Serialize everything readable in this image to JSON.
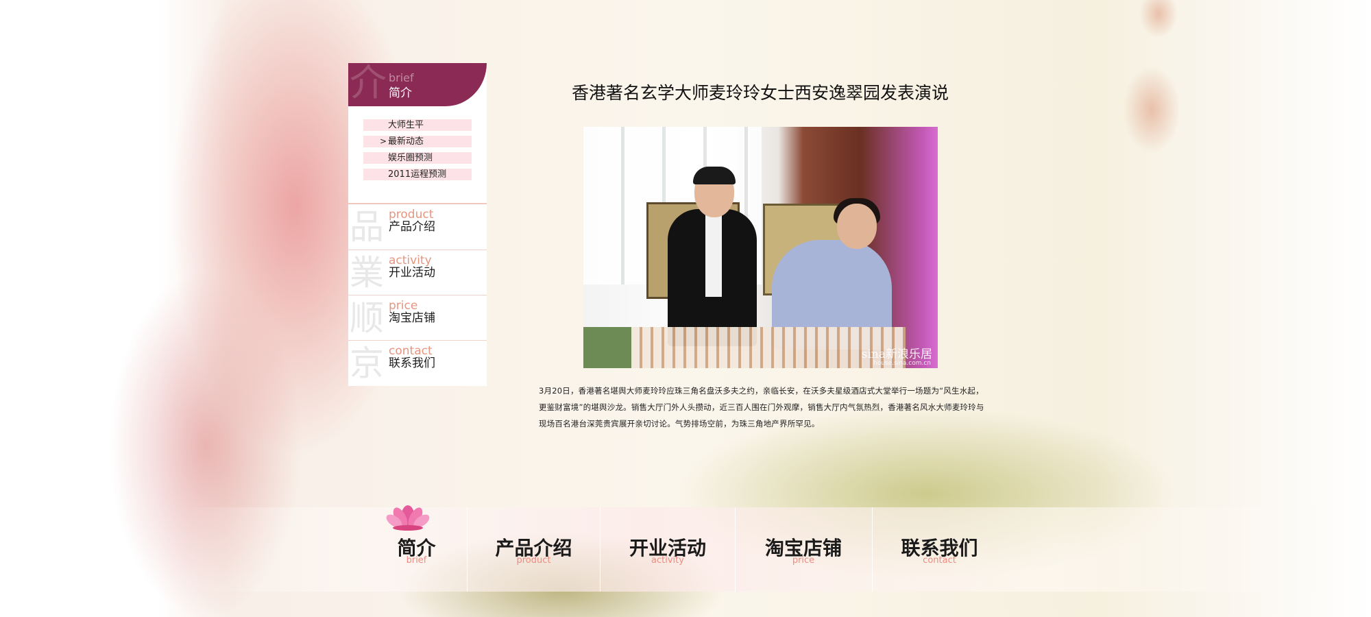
{
  "sidebar": {
    "brief": {
      "seal": "介",
      "en": "brief",
      "cn": "简介"
    },
    "sub_items": [
      {
        "label": "大师生平",
        "active": false
      },
      {
        "label": "最新动态",
        "active": true,
        "marker": ">"
      },
      {
        "label": "娱乐圈预测",
        "active": false
      },
      {
        "label": "2011运程预测",
        "active": false
      }
    ],
    "nav": [
      {
        "seal": "品",
        "en": "product",
        "cn": "产品介绍"
      },
      {
        "seal": "業",
        "en": "activity",
        "cn": "开业活动"
      },
      {
        "seal": "顺",
        "en": "price",
        "cn": "淘宝店铺"
      },
      {
        "seal": "京",
        "en": "contact",
        "cn": "联系我们"
      }
    ]
  },
  "article": {
    "title": "香港著名玄学大师麦玲玲女士西安逸翠园发表演说",
    "photo": {
      "watermark_logo": "sina新浪乐居",
      "watermark_url": "house.sina.com.cn"
    },
    "body": "3月20日，香港著名堪舆大师麦玲玲应珠三角名盘沃多夫之约，亲临长安，在沃多夫星级酒店式大堂举行一场题为“风生水起，更鉴财富境”的堪舆沙龙。销售大厅门外人头攒动，近三百人围在门外观摩，销售大厅内气氛热烈，香港著名风水大师麦玲玲与现场百名港台深莞贵宾展开亲切讨论。气势排场空前，为珠三角地产界所罕见。"
  },
  "bottom_nav": [
    {
      "cn": "简介",
      "en": "brief"
    },
    {
      "cn": "产品介绍",
      "en": "product"
    },
    {
      "cn": "开业活动",
      "en": "activity"
    },
    {
      "cn": "淘宝店铺",
      "en": "price"
    },
    {
      "cn": "联系我们",
      "en": "contact"
    }
  ],
  "colors": {
    "accent": "#8a2a55",
    "sub_item_bg": "#fde3e7",
    "english_label": "#e7957f"
  }
}
